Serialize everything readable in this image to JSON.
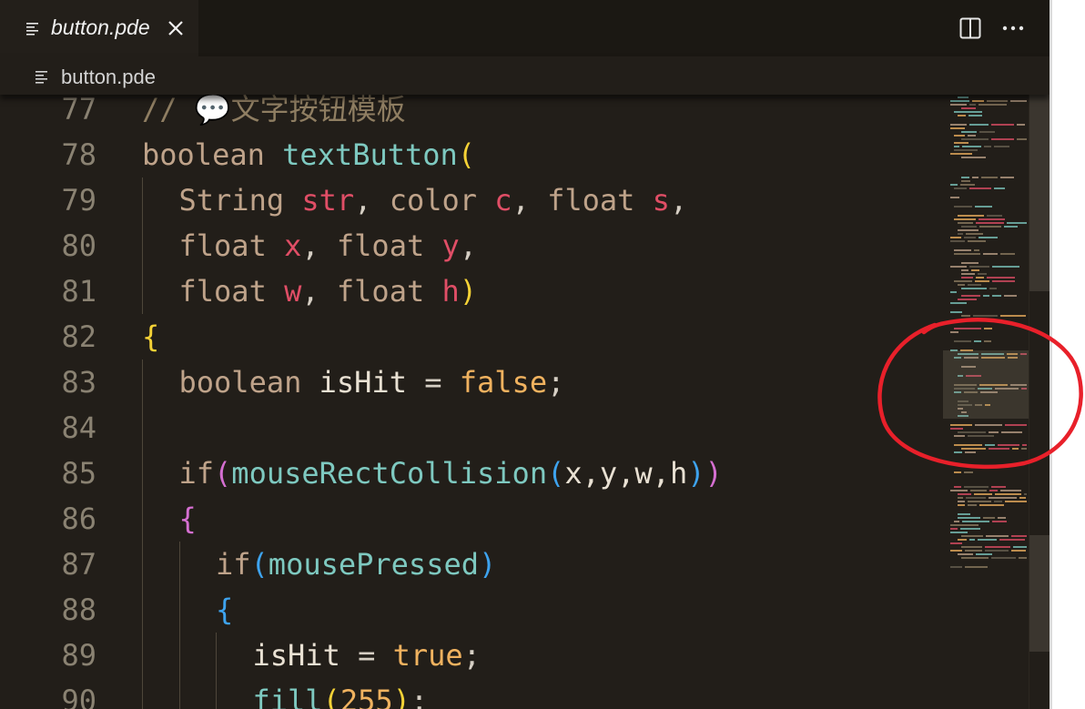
{
  "tab": {
    "label": "button.pde"
  },
  "breadcrumb": {
    "label": "button.pde"
  },
  "icons": {
    "file": "file-lines-icon",
    "close": "close-icon",
    "split": "split-editor-icon",
    "more": "more-actions-icon"
  },
  "colors": {
    "background": "#221e19",
    "comment": "#8f7e62",
    "keyword": "#bfa38a",
    "function": "#7ec9c0",
    "parameter": "#e04e66",
    "boolean": "#f0b25f",
    "annotation": "#e8202a"
  },
  "code_lines": [
    {
      "number": "77",
      "indent": 0,
      "tokens": [
        {
          "text": "// ",
          "type": "comment"
        },
        {
          "text": "💬",
          "type": "comment"
        },
        {
          "text": "文字按钮模板",
          "type": "comment"
        }
      ]
    },
    {
      "number": "78",
      "indent": 0,
      "tokens": [
        {
          "text": "boolean ",
          "type": "keyword"
        },
        {
          "text": "textButton",
          "type": "func"
        },
        {
          "text": "(",
          "type": "p1"
        }
      ]
    },
    {
      "number": "79",
      "indent": 1,
      "tokens": [
        {
          "text": "String ",
          "type": "keyword"
        },
        {
          "text": "str",
          "type": "param"
        },
        {
          "text": ", ",
          "type": "punct"
        },
        {
          "text": "color ",
          "type": "keyword"
        },
        {
          "text": "c",
          "type": "param"
        },
        {
          "text": ", ",
          "type": "punct"
        },
        {
          "text": "float ",
          "type": "keyword"
        },
        {
          "text": "s",
          "type": "param"
        },
        {
          "text": ",",
          "type": "punct"
        }
      ]
    },
    {
      "number": "80",
      "indent": 1,
      "tokens": [
        {
          "text": "float ",
          "type": "keyword"
        },
        {
          "text": "x",
          "type": "param"
        },
        {
          "text": ", ",
          "type": "punct"
        },
        {
          "text": "float ",
          "type": "keyword"
        },
        {
          "text": "y",
          "type": "param"
        },
        {
          "text": ",",
          "type": "punct"
        }
      ]
    },
    {
      "number": "81",
      "indent": 1,
      "tokens": [
        {
          "text": "float ",
          "type": "keyword"
        },
        {
          "text": "w",
          "type": "param"
        },
        {
          "text": ", ",
          "type": "punct"
        },
        {
          "text": "float ",
          "type": "keyword"
        },
        {
          "text": "h",
          "type": "param"
        },
        {
          "text": ")",
          "type": "p1"
        }
      ]
    },
    {
      "number": "82",
      "indent": 0,
      "tokens": [
        {
          "text": "{",
          "type": "p1"
        }
      ]
    },
    {
      "number": "83",
      "indent": 1,
      "tokens": [
        {
          "text": "boolean ",
          "type": "keyword"
        },
        {
          "text": "isHit",
          "type": "ident"
        },
        {
          "text": " = ",
          "type": "punct"
        },
        {
          "text": "false",
          "type": "bool"
        },
        {
          "text": ";",
          "type": "punct"
        }
      ]
    },
    {
      "number": "84",
      "indent": 1,
      "tokens": []
    },
    {
      "number": "85",
      "indent": 1,
      "tokens": [
        {
          "text": "if",
          "type": "keyword"
        },
        {
          "text": "(",
          "type": "p2"
        },
        {
          "text": "mouseRectCollision",
          "type": "func"
        },
        {
          "text": "(",
          "type": "p3"
        },
        {
          "text": "x,y,w,h",
          "type": "ident"
        },
        {
          "text": ")",
          "type": "p3"
        },
        {
          "text": ")",
          "type": "p2"
        }
      ]
    },
    {
      "number": "86",
      "indent": 1,
      "tokens": [
        {
          "text": "{",
          "type": "p2"
        }
      ]
    },
    {
      "number": "87",
      "indent": 2,
      "tokens": [
        {
          "text": "if",
          "type": "keyword"
        },
        {
          "text": "(",
          "type": "p3"
        },
        {
          "text": "mousePressed",
          "type": "func"
        },
        {
          "text": ")",
          "type": "p3"
        }
      ]
    },
    {
      "number": "88",
      "indent": 2,
      "tokens": [
        {
          "text": "{",
          "type": "p3"
        }
      ]
    },
    {
      "number": "89",
      "indent": 3,
      "tokens": [
        {
          "text": "isHit",
          "type": "ident"
        },
        {
          "text": " = ",
          "type": "punct"
        },
        {
          "text": "true",
          "type": "bool"
        },
        {
          "text": ";",
          "type": "punct"
        }
      ]
    },
    {
      "number": "90",
      "indent": 3,
      "tokens": [
        {
          "text": "fill",
          "type": "func"
        },
        {
          "text": "(",
          "type": "p1"
        },
        {
          "text": "255",
          "type": "number"
        },
        {
          "text": ")",
          "type": "p1"
        },
        {
          "text": ";",
          "type": "punct"
        }
      ]
    }
  ]
}
